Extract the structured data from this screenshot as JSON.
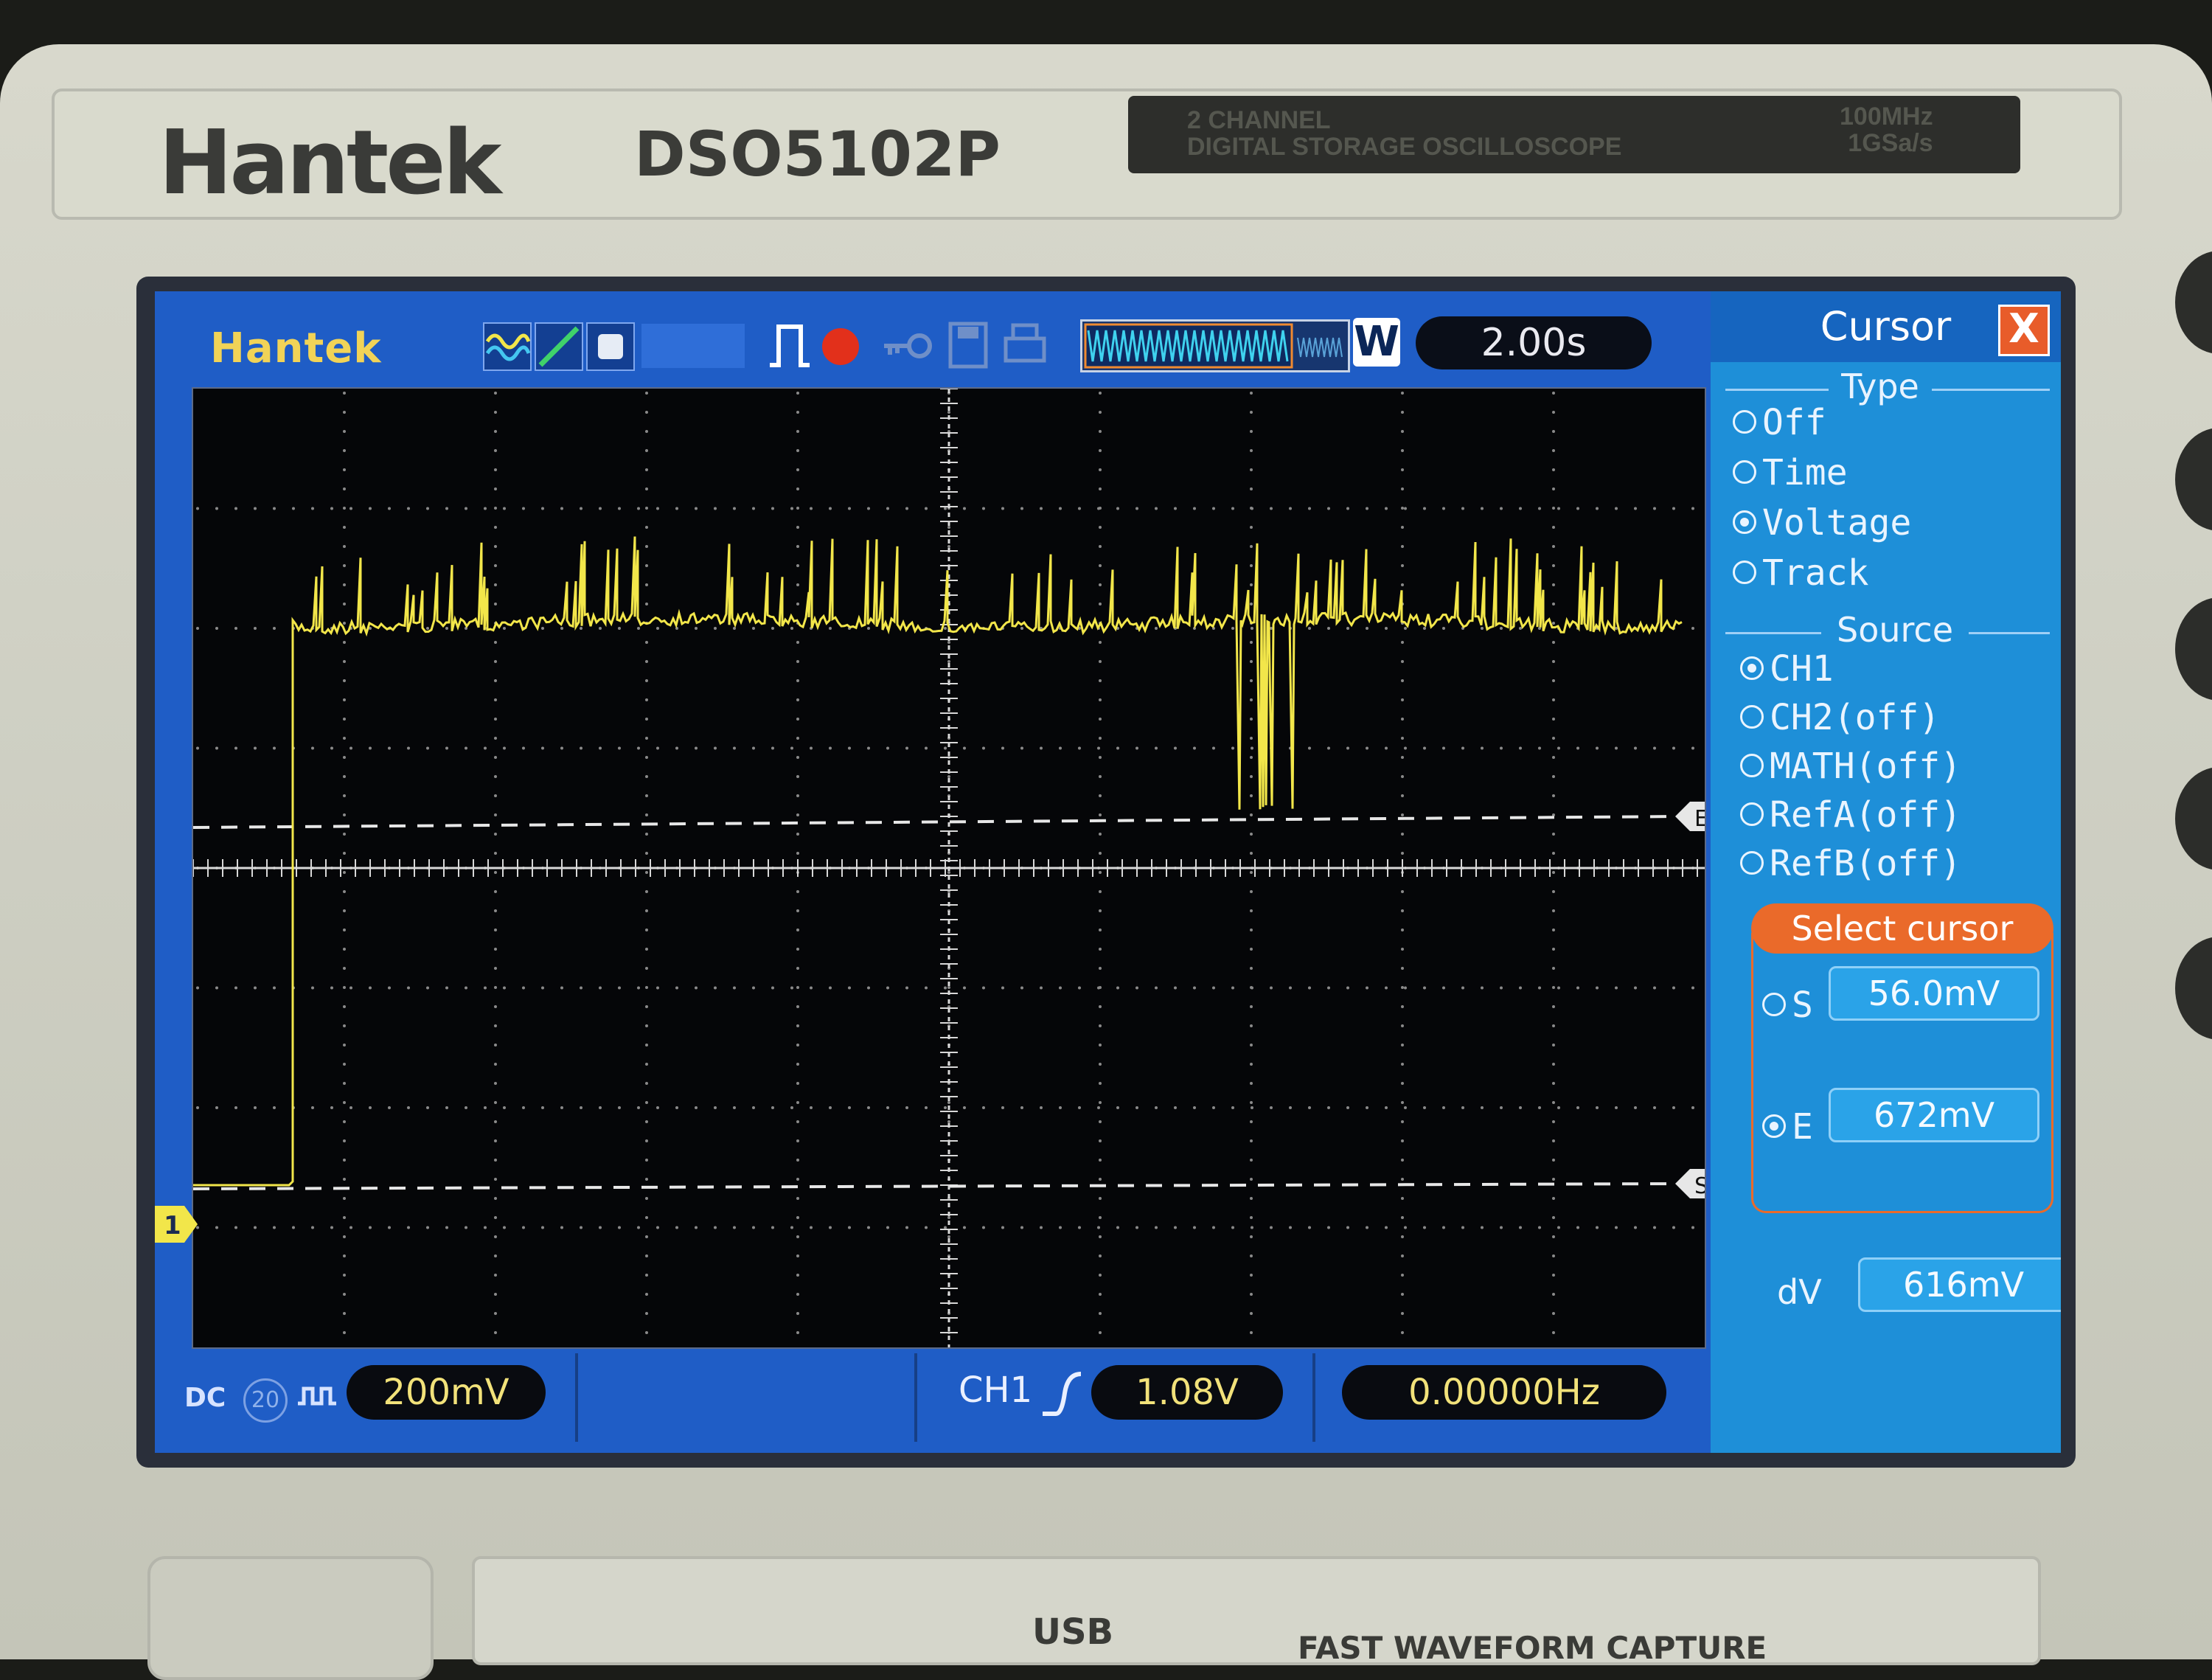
{
  "device": {
    "brand": "Hantek",
    "model": "DSO5102P",
    "plate_line1": "2 CHANNEL",
    "plate_line2": "DIGITAL STORAGE OSCILLOSCOPE",
    "spec_line1": "100MHz",
    "spec_line2": "1GSa/s",
    "usb_label": "USB",
    "capture_label": "FAST WAVEFORM CAPTURE"
  },
  "screen": {
    "logo": "Hantek",
    "memory_mode": "W",
    "timebase": "2.00s",
    "channel_marker": "1",
    "cursor_marker_e": "E",
    "cursor_marker_s": "S"
  },
  "status": {
    "coupling": "DC",
    "bandwidth_limit": "20",
    "volts_per_div": "200mV",
    "trigger_source": "CH1",
    "trigger_level": "1.08V",
    "frequency": "0.00000Hz"
  },
  "cursor_panel": {
    "title": "Cursor",
    "close_symbol": "X",
    "type_title": "Type",
    "type_options": [
      {
        "label": "Off",
        "selected": false
      },
      {
        "label": "Time",
        "selected": false
      },
      {
        "label": "Voltage",
        "selected": true
      },
      {
        "label": "Track",
        "selected": false
      }
    ],
    "source_title": "Source",
    "source_options": [
      {
        "label": "CH1",
        "selected": true
      },
      {
        "label": "CH2(off)",
        "selected": false
      },
      {
        "label": "MATH(off)",
        "selected": false
      },
      {
        "label": "RefA(off)",
        "selected": false
      },
      {
        "label": "RefB(off)",
        "selected": false
      }
    ],
    "select_cursor_label": "Select cursor",
    "s_label": "S",
    "s_selected": false,
    "s_value": "56.0mV",
    "e_label": "E",
    "e_selected": true,
    "e_value": "672mV",
    "dv_label": "dV",
    "dv_value": "616mV"
  },
  "colors": {
    "trace": "#f2e64a",
    "panel_blue": "#1e8fd8",
    "screen_blue": "#1f5dc6",
    "accent_orange": "#ea6a2a"
  }
}
